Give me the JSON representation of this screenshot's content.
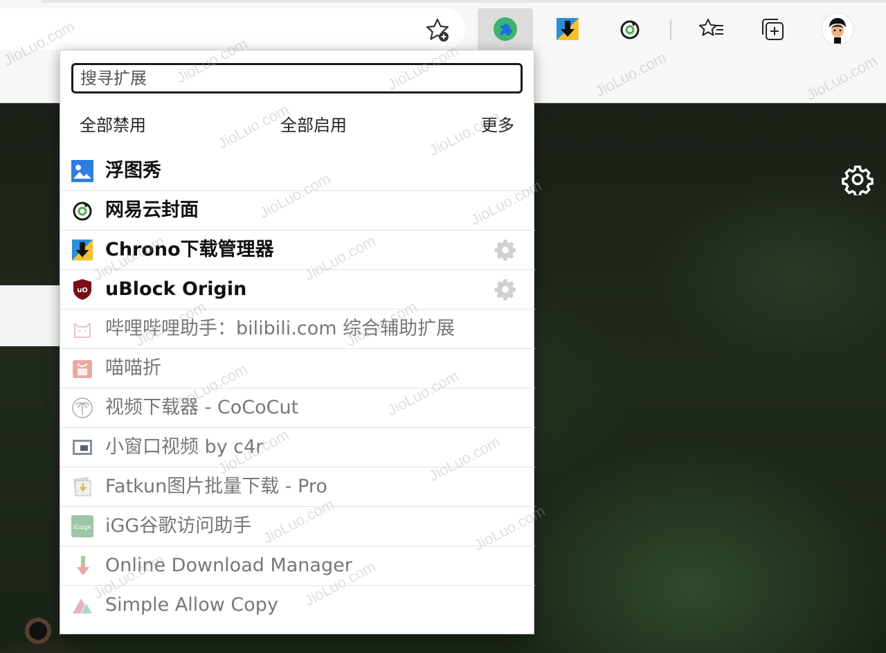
{
  "colors": {
    "toolbar_bg": "#f7f7f7",
    "popup_bg": "#ffffff",
    "active_extension_button_bg": "#dcdcdc",
    "enabled_text": "#111111",
    "disabled_text": "#777777"
  },
  "toolbar": {
    "buttons": [
      {
        "icon": "puzzle-extensions-icon",
        "active": true
      },
      {
        "icon": "chrono-download-icon"
      },
      {
        "icon": "netease-cloud-icon"
      },
      {
        "icon": "favorites-list-icon"
      },
      {
        "icon": "collections-icon"
      },
      {
        "icon": "profile-avatar-icon"
      }
    ]
  },
  "popup": {
    "search_placeholder": "搜寻扩展",
    "disable_all": "全部禁用",
    "enable_all": "全部启用",
    "more": "更多",
    "extensions": [
      {
        "name": "浮图秀",
        "enabled": true,
        "icon": "image-icon",
        "has_settings": false
      },
      {
        "name": "网易云封面",
        "enabled": true,
        "icon": "netease-icon",
        "has_settings": false
      },
      {
        "name": "Chrono下载管理器",
        "enabled": true,
        "icon": "chrono-icon",
        "has_settings": true
      },
      {
        "name": "uBlock Origin",
        "enabled": true,
        "icon": "ublock-shield-icon",
        "has_settings": true
      },
      {
        "name": "哔哩哔哩助手：bilibili.com 综合辅助扩展",
        "enabled": false,
        "icon": "bilibili-cat-icon",
        "has_settings": false
      },
      {
        "name": "喵喵折",
        "enabled": false,
        "icon": "miaomiaozhe-bag-icon",
        "has_settings": false
      },
      {
        "name": "视频下载器 - CoCoCut",
        "enabled": false,
        "icon": "palm-tree-icon",
        "has_settings": false
      },
      {
        "name": "小窗口视频 by c4r",
        "enabled": false,
        "icon": "pip-window-icon",
        "has_settings": false
      },
      {
        "name": "Fatkun图片批量下载 - Pro",
        "enabled": false,
        "icon": "fatkun-icon",
        "has_settings": false
      },
      {
        "name": "iGG谷歌访问助手",
        "enabled": false,
        "icon": "iguge-icon",
        "has_settings": false
      },
      {
        "name": "Online Download Manager",
        "enabled": false,
        "icon": "download-arrow-icon",
        "has_settings": false
      },
      {
        "name": "Simple Allow Copy",
        "enabled": false,
        "icon": "allow-copy-icon",
        "has_settings": false
      }
    ]
  },
  "watermark": "JioLuo.com"
}
